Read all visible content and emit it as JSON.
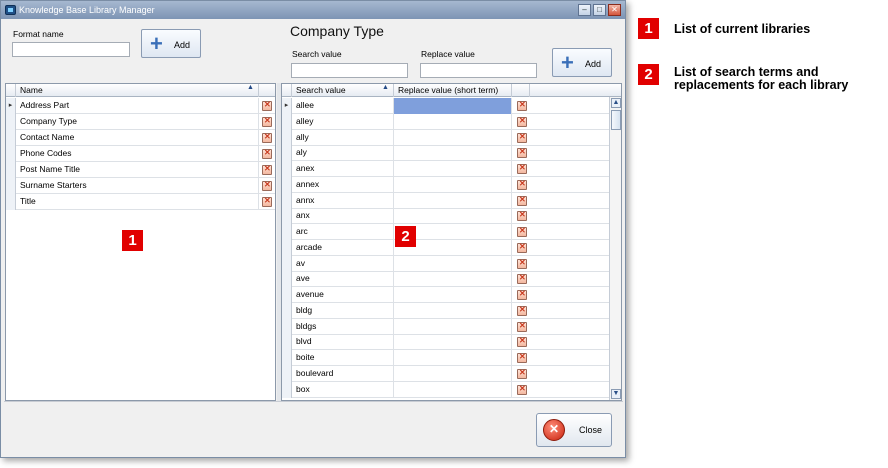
{
  "window": {
    "title": "Knowledge Base Library Manager"
  },
  "left": {
    "format_label": "Format name",
    "format_value": "",
    "add_label": "Add",
    "grid": {
      "header": "Name",
      "rows": [
        "Address Part",
        "Company Type",
        "Contact Name",
        "Phone Codes",
        "Post Name Title",
        "Surname Starters",
        "Title"
      ]
    }
  },
  "right": {
    "title": "Company Type",
    "search_label": "Search value",
    "replace_label": "Replace value",
    "search_value": "",
    "replace_value": "",
    "add_label": "Add",
    "grid": {
      "headers": [
        "Search value",
        "Replace value (short term)"
      ],
      "rows": [
        "allee",
        "alley",
        "ally",
        "aly",
        "anex",
        "annex",
        "annx",
        "anx",
        "arc",
        "arcade",
        "av",
        "ave",
        "avenue",
        "bldg",
        "bldgs",
        "blvd",
        "boite",
        "boulevard",
        "box"
      ]
    }
  },
  "close_label": "Close",
  "annotations": [
    {
      "num": "1",
      "text": "List of current libraries"
    },
    {
      "num": "2",
      "text": "List of search terms and replacements for each library"
    }
  ],
  "colors": {
    "selection": "#7f9fdc",
    "marker": "#e10000"
  }
}
